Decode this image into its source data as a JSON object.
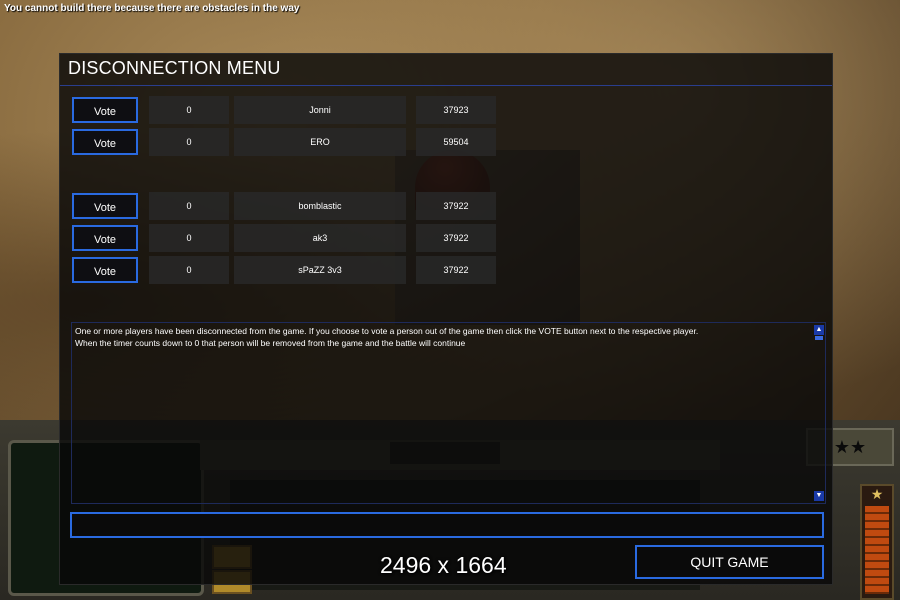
{
  "status_message": "You cannot build there because there are obstacles in the way",
  "menu": {
    "title": "DISCONNECTION MENU",
    "vote_label": "Vote",
    "players_group1": [
      {
        "count": "0",
        "name": "Jonni",
        "score": "37923"
      },
      {
        "count": "0",
        "name": "ERO",
        "score": "59504"
      }
    ],
    "players_group2": [
      {
        "count": "0",
        "name": "bomblastic",
        "score": "37922"
      },
      {
        "count": "0",
        "name": "ak3",
        "score": "37922"
      },
      {
        "count": "0",
        "name": "sPaZZ 3v3",
        "score": "37922"
      }
    ],
    "message": "One or more players have been disconnected from the game. If you choose to vote a person out of the game then click the VOTE button next to the respective player.\n When the timer counts down to 0 that person will be removed from the game and the battle will continue",
    "chat_value": "",
    "quit_label": "QUIT GAME"
  },
  "overlay_resolution": "2496 x 1664",
  "colors": {
    "accent": "#2a6ae0",
    "panel": "#0e0e12",
    "text": "#ffffff"
  },
  "icons": [
    "scroll-up-icon",
    "scroll-down-icon",
    "rank-star-icon"
  ]
}
